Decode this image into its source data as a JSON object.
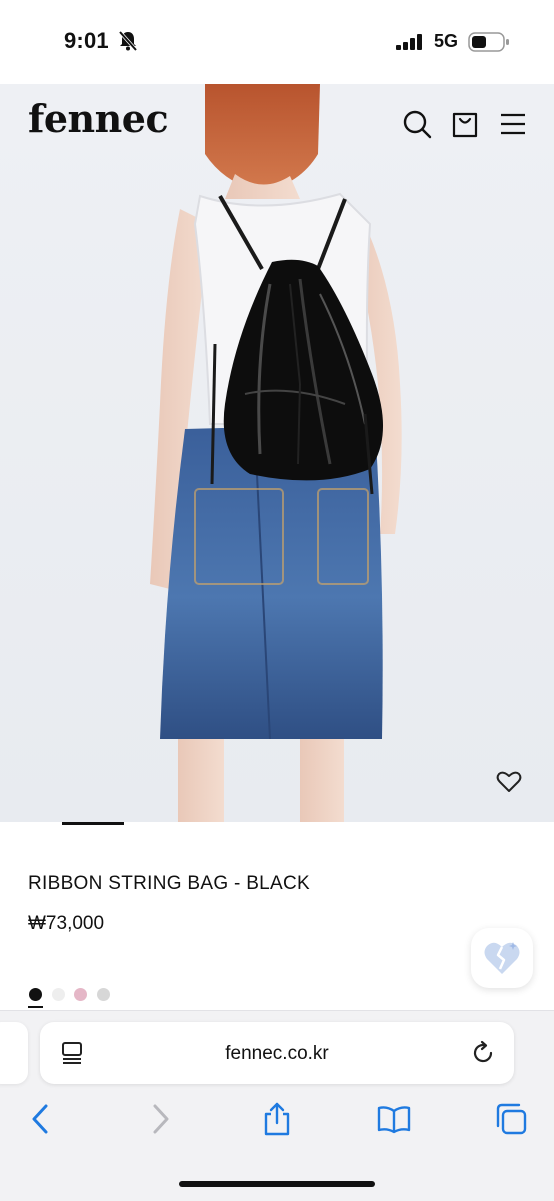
{
  "status_bar": {
    "time": "9:01",
    "network": "5G",
    "icons": [
      "bell-slash-icon",
      "cellular-signal-icon",
      "battery-icon"
    ]
  },
  "site": {
    "logo": "fennec",
    "header_icons": [
      "search-icon",
      "shopping-bag-icon",
      "menu-icon"
    ]
  },
  "product": {
    "name": "RIBBON STRING BAG - BLACK",
    "price": "₩73,000",
    "wishlist_icon": "heart-outline-icon",
    "swatches": [
      "#111111",
      "#eeeeee",
      "#e5b7c7",
      "#d7d7d7"
    ],
    "selected_swatch": 0
  },
  "floating_button": {
    "icon": "broken-heart-sparkle-icon"
  },
  "browser": {
    "url": "fennec.co.kr",
    "toolbar": [
      "back-icon",
      "forward-icon",
      "share-icon",
      "bookmarks-icon",
      "tabs-icon"
    ]
  },
  "colors": {
    "text": "#111111",
    "chrome_bg": "#f2f2f4",
    "accent_blue": "#1f7ae0"
  }
}
